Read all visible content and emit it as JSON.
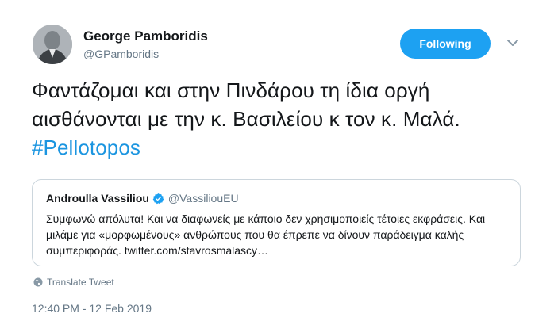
{
  "author": {
    "name": "George Pamboridis",
    "handle": "@GPamboridis",
    "avatar_icon": "profile-photo"
  },
  "follow_button": {
    "label": "Following",
    "color": "#1da1f2"
  },
  "menu_icon": "chevron-down-icon",
  "tweet": {
    "text": "Φαντάζομαι και στην Πινδάρου τη ίδια οργή αισθάνονται με την κ. Βασιλείου κ τον κ. Μαλά. ",
    "hashtag": "#Pellotopos",
    "hashtag_color": "#1b95e0"
  },
  "quoted_tweet": {
    "name": "Androulla Vassiliou",
    "verified_icon": "verified-badge-icon",
    "handle": "@VassiliouEU",
    "text": "Συμφωνώ απόλυτα! Και να διαφωνείς με κάποιο δεν χρησιμοποιείς τέτοιες εκφράσεις. Και μιλάμε για «μορφωμένους» ανθρώπους που θα έπρεπε να δίνουν παράδειγμα καλής συμπεριφοράς. twitter.com/stavrosmalascy…"
  },
  "translate": {
    "icon": "globe-icon",
    "label": "Translate Tweet"
  },
  "timestamp": "12:40 PM - 12 Feb 2019"
}
